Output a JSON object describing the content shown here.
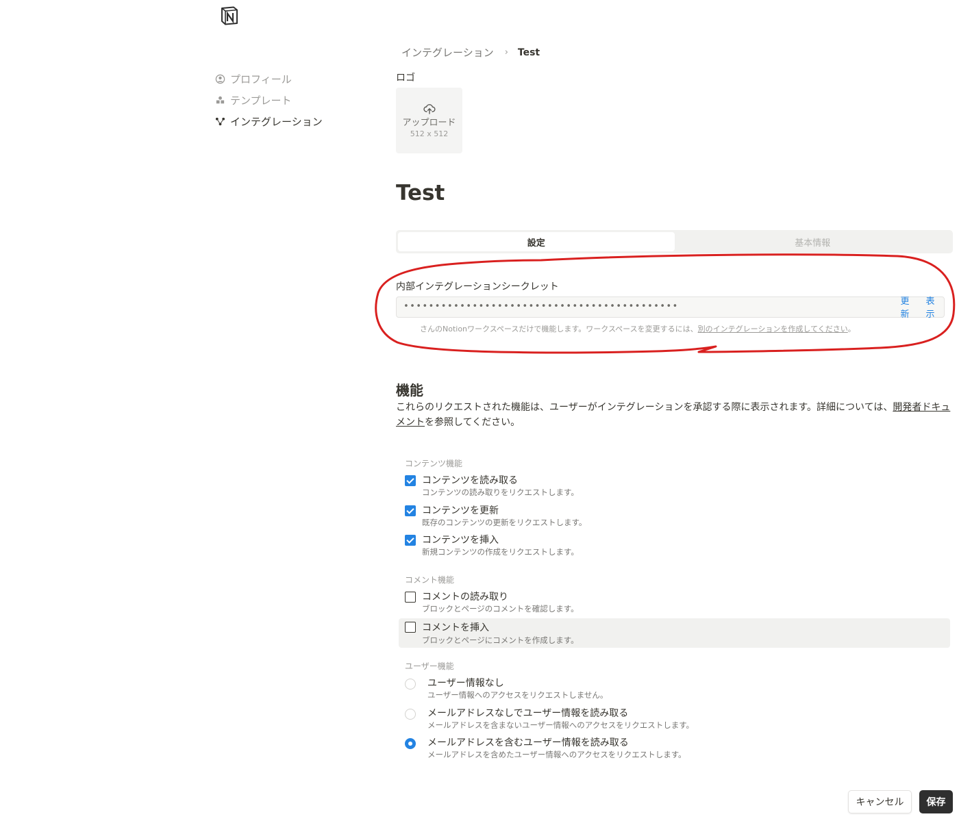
{
  "app": {
    "logo_icon": "notion-logo-icon"
  },
  "sidebar": {
    "items": [
      {
        "label": "プロフィール",
        "icon": "profile-icon",
        "active": false
      },
      {
        "label": "テンプレート",
        "icon": "template-icon",
        "active": false
      },
      {
        "label": "インテグレーション",
        "icon": "integration-icon",
        "active": true
      }
    ]
  },
  "breadcrumb": {
    "parent": "インテグレーション",
    "separator": "›",
    "current": "Test"
  },
  "logo_section": {
    "label": "ロゴ",
    "upload_label": "アップロード",
    "size": "512 x 512"
  },
  "page_title": "Test",
  "tabs": [
    {
      "label": "設定",
      "active": true
    },
    {
      "label": "基本情報",
      "active": false
    }
  ],
  "secret": {
    "label": "内部インテグレーションシークレット",
    "masked_value": "••••••••••••••••••••••••••••••••••••••••••••",
    "refresh_label": "更新",
    "show_label": "表示",
    "note_text": "さんのNotionワークスペースだけで機能します。ワークスペースを変更するには、",
    "note_link": "別のインテグレーションを作成してください",
    "note_end": "。"
  },
  "features": {
    "heading": "機能",
    "desc_text": "これらのリクエストされた機能は、ユーザーがインテグレーションを承認する際に表示されます。詳細については、",
    "desc_link": "開発者ドキュメント",
    "desc_end": "を参照してください。",
    "content_group": {
      "label": "コンテンツ機能",
      "options": [
        {
          "label": "コンテンツを読み取る",
          "sub": "コンテンツの読み取りをリクエストします。",
          "checked": true
        },
        {
          "label": "コンテンツを更新",
          "sub": "既存のコンテンツの更新をリクエストします。",
          "checked": true
        },
        {
          "label": "コンテンツを挿入",
          "sub": "新規コンテンツの作成をリクエストします。",
          "checked": true
        }
      ]
    },
    "comment_group": {
      "label": "コメント機能",
      "options": [
        {
          "label": "コメントの読み取り",
          "sub": "ブロックとページのコメントを確認します。",
          "checked": false
        },
        {
          "label": "コメントを挿入",
          "sub": "ブロックとページにコメントを作成します。",
          "checked": false
        }
      ]
    },
    "user_group": {
      "label": "ユーザー機能",
      "options": [
        {
          "label": "ユーザー情報なし",
          "sub": "ユーザー情報へのアクセスをリクエストしません。",
          "selected": false
        },
        {
          "label": "メールアドレスなしでユーザー情報を読み取る",
          "sub": "メールアドレスを含まないユーザー情報へのアクセスをリクエストします。",
          "selected": false
        },
        {
          "label": "メールアドレスを含むユーザー情報を読み取る",
          "sub": "メールアドレスを含めたユーザー情報へのアクセスをリクエストします。",
          "selected": true
        }
      ]
    }
  },
  "footer": {
    "cancel_label": "キャンセル",
    "save_label": "保存"
  },
  "colors": {
    "accent": "#2383e2",
    "annotation": "#d9201f",
    "save_bg": "#2f2f2f"
  }
}
